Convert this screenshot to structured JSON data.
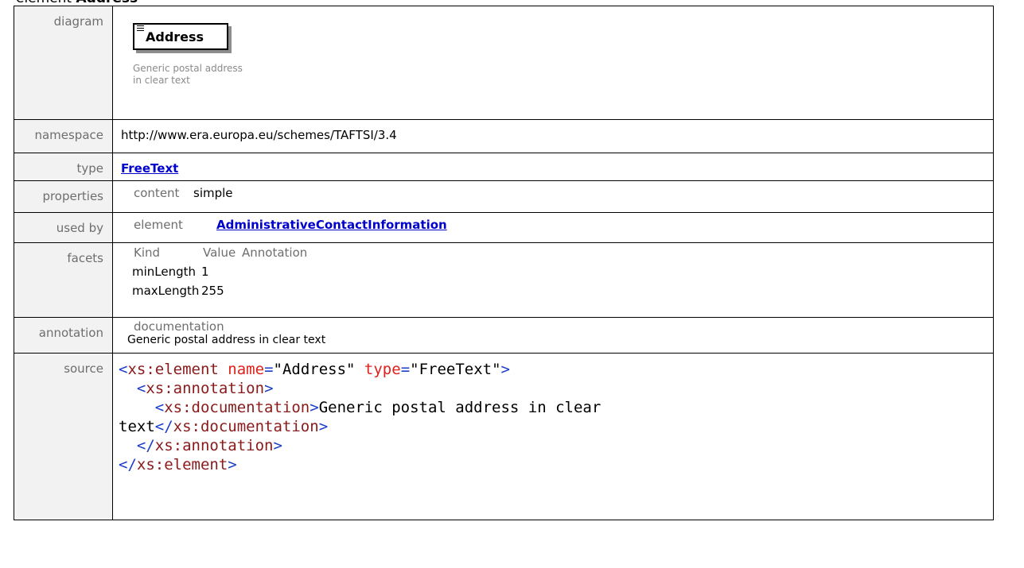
{
  "heading": {
    "prefix": "element ",
    "name": "Address"
  },
  "rows": {
    "diagram": {
      "label": "diagram",
      "box_name": "Address",
      "doc": "Generic postal address in clear text"
    },
    "namespace": {
      "label": "namespace",
      "value": "http://www.era.europa.eu/schemes/TAFTSI/3.4"
    },
    "type": {
      "label": "type",
      "value": "FreeText"
    },
    "properties": {
      "label": "properties",
      "key": "content",
      "value": "simple"
    },
    "used_by": {
      "label": "used by",
      "key": "element",
      "value": "AdministrativeContactInformation"
    },
    "facets": {
      "label": "facets",
      "headers": [
        "Kind",
        "Value",
        "Annotation"
      ],
      "rows": [
        {
          "kind": "minLength",
          "value": "1"
        },
        {
          "kind": "maxLength",
          "value": "255"
        }
      ]
    },
    "annotation": {
      "label": "annotation",
      "key": "documentation",
      "value": "Generic postal address in clear text"
    },
    "source": {
      "label": "source",
      "xs_element": "xs:element",
      "attr_name": "name",
      "attr_name_val": "\"Address\"",
      "attr_type": "type",
      "attr_type_val": "\"FreeText\"",
      "xs_annotation": "xs:annotation",
      "xs_documentation": "xs:documentation",
      "doc_text_1": "Generic postal address in clear",
      "doc_text_2": "text"
    }
  }
}
